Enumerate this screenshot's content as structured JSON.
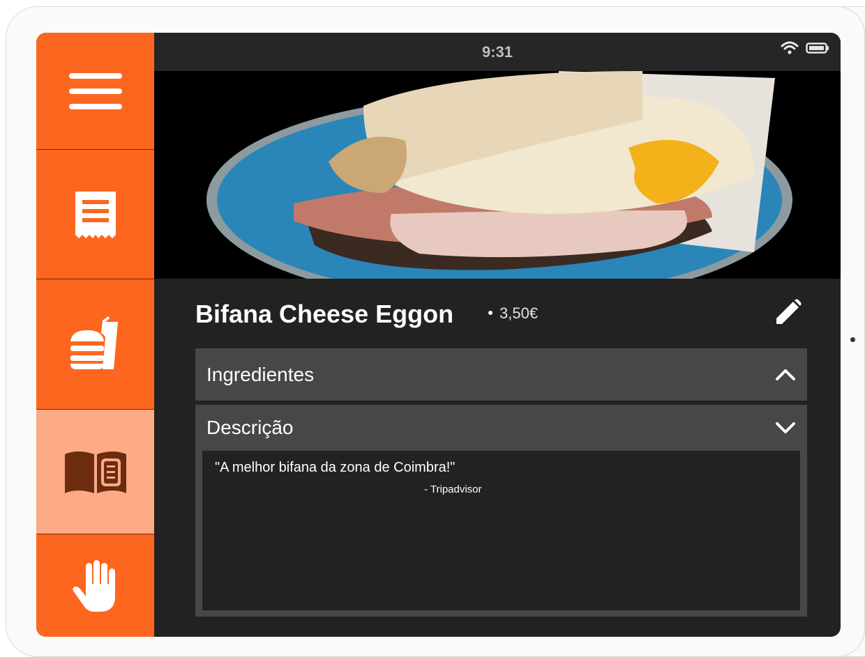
{
  "status_bar": {
    "time": "9:31",
    "icons": [
      "wifi-icon",
      "battery-icon"
    ]
  },
  "sidebar": {
    "items": [
      {
        "name": "menu",
        "icon": "hamburger-menu-icon",
        "active": false
      },
      {
        "name": "receipt",
        "icon": "receipt-icon",
        "active": false
      },
      {
        "name": "food",
        "icon": "burger-drink-icon",
        "active": false
      },
      {
        "name": "catalog",
        "icon": "open-book-icon",
        "active": true
      },
      {
        "name": "call-waiter",
        "icon": "raised-hand-icon",
        "active": false
      }
    ]
  },
  "hero": {
    "icon": "sandwich-photo"
  },
  "item": {
    "name": "Bifana Cheese Eggon",
    "price": "3,50€"
  },
  "sections": {
    "ingredients": {
      "title": "Ingredientes",
      "expanded": false
    },
    "description": {
      "title": "Descrição",
      "expanded": true,
      "quote": "\"A melhor bifana da zona de Coimbra!\"",
      "source": "- Tripadvisor"
    }
  },
  "colors": {
    "accent": "#fd661f",
    "accent_active": "#fdaa86",
    "background": "#222222",
    "panel": "#474747"
  }
}
